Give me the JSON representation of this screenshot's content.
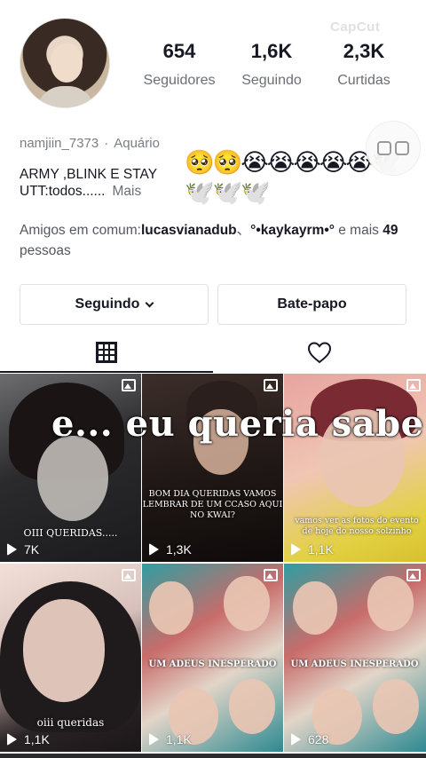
{
  "watermark": "CapCut",
  "profile": {
    "username": "namjiin_7373",
    "zodiac": "Aquário",
    "bio_line1": "ARMY ,BLINK E STAY",
    "bio_line2": "UTT:todos......",
    "more_label": "Mais",
    "emojis": "🥺🥺😭😭😭😭😭🕊️🕊️🕊️🕊️",
    "friends_prefix": "Amigos em comum:",
    "friend1": "lucasvianadub",
    "separator": "、",
    "friend2": "°•kaykayrm•°",
    "friends_mid": " e mais ",
    "friends_count": "49",
    "friends_suffix": " pessoas"
  },
  "stats": [
    {
      "value": "654",
      "label": "Seguidores"
    },
    {
      "value": "1,6K",
      "label": "Seguindo"
    },
    {
      "value": "2,3K",
      "label": "Curtidas"
    }
  ],
  "buttons": {
    "following": "Seguindo",
    "chat": "Bate-papo"
  },
  "tabs": {
    "videos_icon": "grid-icon",
    "liked_icon": "heart-outline-icon"
  },
  "overlay": "e... eu queria sabe",
  "videos": [
    {
      "views": "7K",
      "caption": "OIII QUERIDAS....."
    },
    {
      "views": "1,3K",
      "caption": "BOM DIA QUERIDAS VAMOS LEMBRAR DE UM CCASO AQUI NO KWAI?"
    },
    {
      "views": "1,1K",
      "caption": "vamos ver as fotos do evento de hoje do nosso solzinho"
    },
    {
      "views": "1,1K",
      "caption": "oiii queridas"
    },
    {
      "views": "1,1K",
      "caption": "UM ADEUS INESPERADO"
    },
    {
      "views": "628",
      "caption": "UM ADEUS INESPERADO"
    }
  ]
}
